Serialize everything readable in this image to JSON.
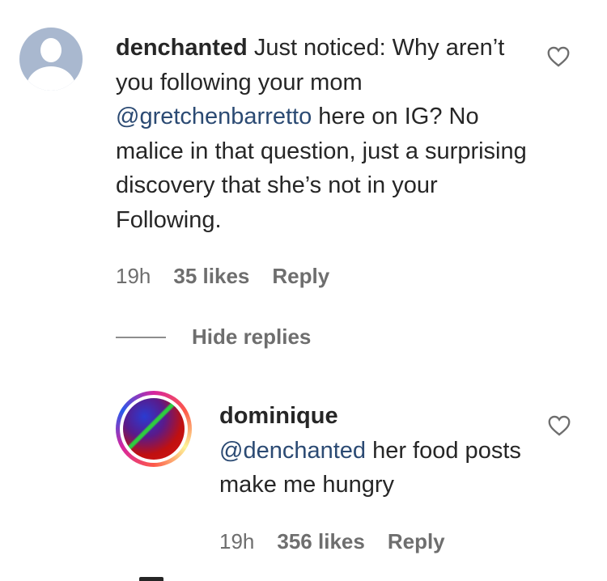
{
  "comment": {
    "username": "denchanted",
    "text_before_mention": "Just noticed: Why aren’t you following your mom ",
    "mention": "@gretchenbarretto",
    "text_after_mention": " here on IG? No malice in that question, just a surprising discovery that she’s not in your Following.",
    "time": "19h",
    "likes": "35 likes",
    "reply_label": "Reply",
    "avatar_icon": "default-profile-icon",
    "like_icon": "heart-outline-icon"
  },
  "hide_replies_label": "Hide replies",
  "reply": {
    "username": "dominique",
    "mention": "@denchanted",
    "text": " her food posts make me hungry",
    "time": "19h",
    "likes": "356 likes",
    "reply_label": "Reply",
    "avatar_icon": "story-ring-avatar",
    "like_icon": "heart-outline-icon"
  },
  "colors": {
    "text": "#262626",
    "mention": "#2b4a73",
    "meta": "#6e6e6e",
    "avatar_default_bg": "#a9b8cf"
  }
}
